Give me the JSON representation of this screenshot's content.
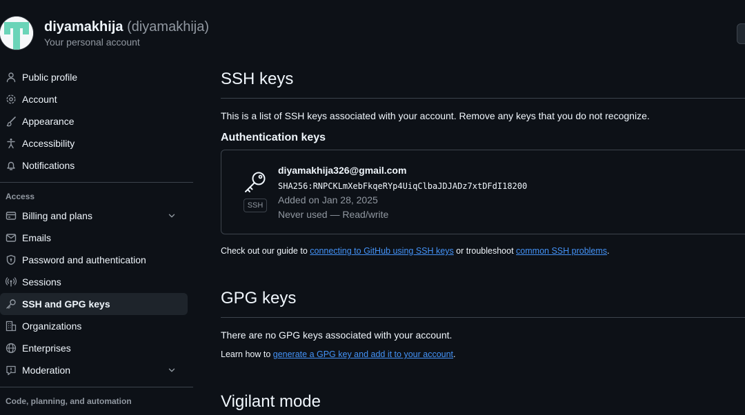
{
  "header": {
    "user_name": "diyamakhija",
    "user_handle": "(diyamakhija)",
    "subtitle": "Your personal account"
  },
  "sidebar": {
    "items": [
      {
        "label": "Public profile",
        "icon": "person-icon"
      },
      {
        "label": "Account",
        "icon": "gear-icon"
      },
      {
        "label": "Appearance",
        "icon": "paintbrush-icon"
      },
      {
        "label": "Accessibility",
        "icon": "accessibility-icon"
      },
      {
        "label": "Notifications",
        "icon": "bell-icon"
      }
    ],
    "access_label": "Access",
    "access_items": [
      {
        "label": "Billing and plans",
        "icon": "credit-card-icon"
      },
      {
        "label": "Emails",
        "icon": "mail-icon"
      },
      {
        "label": "Password and authentication",
        "icon": "shield-lock-icon"
      },
      {
        "label": "Sessions",
        "icon": "broadcast-icon"
      },
      {
        "label": "SSH and GPG keys",
        "icon": "key-icon"
      },
      {
        "label": "Organizations",
        "icon": "organization-icon"
      },
      {
        "label": "Enterprises",
        "icon": "globe-icon"
      },
      {
        "label": "Moderation",
        "icon": "report-icon"
      }
    ],
    "code_label": "Code, planning, and automation"
  },
  "main": {
    "ssh_title": "SSH keys",
    "ssh_desc": "This is a list of SSH keys associated with your account. Remove any keys that you do not recognize.",
    "auth_keys_title": "Authentication keys",
    "key": {
      "badge": "SSH",
      "email": "diyamakhija326@gmail.com",
      "fingerprint": "SHA256:RNPCKLmXebFkqeRYp4UiqClbaJDJADz7xtDFdI18200",
      "added": "Added on Jan 28, 2025",
      "usage": "Never used — Read/write"
    },
    "guide": {
      "prefix": "Check out our guide to ",
      "link1": "connecting to GitHub using SSH keys",
      "middle": " or troubleshoot ",
      "link2": "common SSH problems",
      "suffix": "."
    },
    "gpg_title": "GPG keys",
    "gpg_empty": "There are no GPG keys associated with your account.",
    "gpg_learn": {
      "prefix": "Learn how to ",
      "link": "generate a GPG key and add it to your account",
      "suffix": "."
    },
    "vigilant_title": "Vigilant mode"
  },
  "colors": {
    "background": "#0d1117",
    "text": "#f0f6fc",
    "muted": "#9198a1",
    "link": "#4493f8",
    "border": "#3d444d",
    "active_bg": "#1e242b",
    "avatar_accent": "#6ad4b8"
  }
}
